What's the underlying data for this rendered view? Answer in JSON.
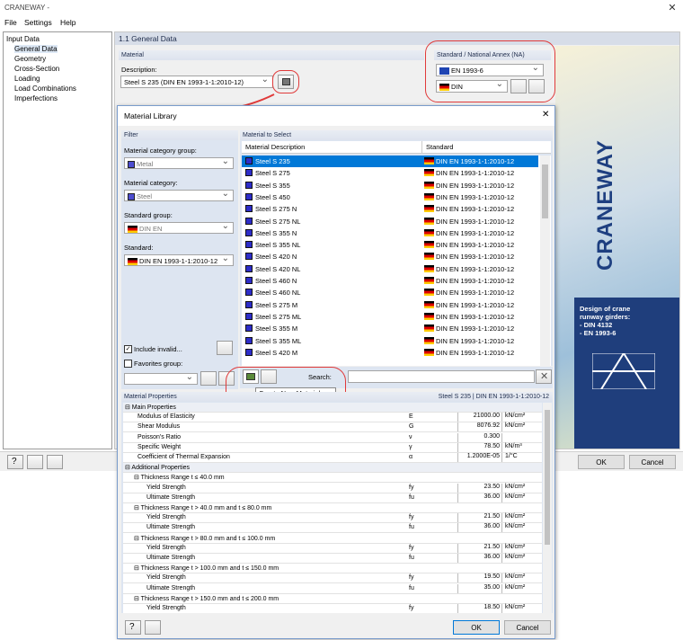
{
  "window": {
    "title": "CRANEWAY -",
    "close": "✕"
  },
  "menu": [
    "File",
    "Settings",
    "Help"
  ],
  "nav": {
    "root": "Input Data",
    "items": [
      "General Data",
      "Geometry",
      "Cross-Section",
      "Loading",
      "Load Combinations",
      "Imperfections"
    ]
  },
  "main": {
    "header": "1.1 General Data",
    "material_section": "Material",
    "description_label": "Description:",
    "description_value": "Steel S 235 (DIN EN 1993-1-1:2010-12)",
    "standard_section": "Standard / National Annex (NA)",
    "standard_value": "EN 1993-6",
    "na_value": "DIN"
  },
  "banner": {
    "word": "CRANEWAY",
    "text1": "Design of crane",
    "text2": "runway girders:",
    "text3": "- DIN 4132",
    "text4": "- EN 1993-6"
  },
  "bottom": {
    "ok": "OK",
    "cancel": "Cancel"
  },
  "dialog": {
    "title": "Material Library",
    "close": "✕",
    "filter": {
      "header": "Filter",
      "cat_group_label": "Material category group:",
      "cat_group_value": "Metal",
      "cat_label": "Material category:",
      "cat_value": "Steel",
      "std_group_label": "Standard group:",
      "std_group_value": "DIN EN",
      "std_label": "Standard:",
      "std_value": "DIN EN 1993-1-1:2010-12",
      "include_invalid": "Include invalid...",
      "favorites": "Favorites group:"
    },
    "select": {
      "header": "Material to Select",
      "col_desc": "Material Description",
      "col_std": "Standard",
      "rows": [
        [
          "Steel S 235",
          "DIN EN 1993-1-1:2010-12"
        ],
        [
          "Steel S 275",
          "DIN EN 1993-1-1:2010-12"
        ],
        [
          "Steel S 355",
          "DIN EN 1993-1-1:2010-12"
        ],
        [
          "Steel S 450",
          "DIN EN 1993-1-1:2010-12"
        ],
        [
          "Steel S 275 N",
          "DIN EN 1993-1-1:2010-12"
        ],
        [
          "Steel S 275 NL",
          "DIN EN 1993-1-1:2010-12"
        ],
        [
          "Steel S 355 N",
          "DIN EN 1993-1-1:2010-12"
        ],
        [
          "Steel S 355 NL",
          "DIN EN 1993-1-1:2010-12"
        ],
        [
          "Steel S 420 N",
          "DIN EN 1993-1-1:2010-12"
        ],
        [
          "Steel S 420 NL",
          "DIN EN 1993-1-1:2010-12"
        ],
        [
          "Steel S 460 N",
          "DIN EN 1993-1-1:2010-12"
        ],
        [
          "Steel S 460 NL",
          "DIN EN 1993-1-1:2010-12"
        ],
        [
          "Steel S 275 M",
          "DIN EN 1993-1-1:2010-12"
        ],
        [
          "Steel S 275 ML",
          "DIN EN 1993-1-1:2010-12"
        ],
        [
          "Steel S 355 M",
          "DIN EN 1993-1-1:2010-12"
        ],
        [
          "Steel S 355 ML",
          "DIN EN 1993-1-1:2010-12"
        ],
        [
          "Steel S 420 M",
          "DIN EN 1993-1-1:2010-12"
        ]
      ],
      "search_label": "Search:",
      "tooltip": "Create New Material..."
    },
    "props": {
      "header": "Material Properties",
      "header_right": "Steel S 235  |  DIN EN 1993-1-1:2010-12",
      "rows": [
        {
          "t": "group",
          "label": "⊟ Main Properties"
        },
        {
          "t": "item",
          "label": "Modulus of Elasticity",
          "sym": "E",
          "val": "21000.00",
          "unit": "kN/cm²"
        },
        {
          "t": "item",
          "label": "Shear Modulus",
          "sym": "G",
          "val": "8076.92",
          "unit": "kN/cm²"
        },
        {
          "t": "item",
          "label": "Poisson's Ratio",
          "sym": "ν",
          "val": "0.300",
          "unit": ""
        },
        {
          "t": "item",
          "label": "Specific Weight",
          "sym": "γ",
          "val": "78.50",
          "unit": "kN/m³"
        },
        {
          "t": "item",
          "label": "Coefficient of Thermal Expansion",
          "sym": "α",
          "val": "1.2000E-05",
          "unit": "1/°C"
        },
        {
          "t": "group",
          "label": "⊟ Additional Properties"
        },
        {
          "t": "sub",
          "label": "⊟ Thickness Range t ≤ 40.0 mm"
        },
        {
          "t": "leaf",
          "label": "Yield Strength",
          "sym": "fy",
          "val": "23.50",
          "unit": "kN/cm²"
        },
        {
          "t": "leaf",
          "label": "Ultimate Strength",
          "sym": "fu",
          "val": "36.00",
          "unit": "kN/cm²"
        },
        {
          "t": "sub",
          "label": "⊟ Thickness Range t > 40.0 mm and t ≤ 80.0 mm"
        },
        {
          "t": "leaf",
          "label": "Yield Strength",
          "sym": "fy",
          "val": "21.50",
          "unit": "kN/cm²"
        },
        {
          "t": "leaf",
          "label": "Ultimate Strength",
          "sym": "fu",
          "val": "36.00",
          "unit": "kN/cm²"
        },
        {
          "t": "sub",
          "label": "⊟ Thickness Range t > 80.0 mm and t ≤ 100.0 mm"
        },
        {
          "t": "leaf",
          "label": "Yield Strength",
          "sym": "fy",
          "val": "21.50",
          "unit": "kN/cm²"
        },
        {
          "t": "leaf",
          "label": "Ultimate Strength",
          "sym": "fu",
          "val": "36.00",
          "unit": "kN/cm²"
        },
        {
          "t": "sub",
          "label": "⊟ Thickness Range t > 100.0 mm and t ≤ 150.0 mm"
        },
        {
          "t": "leaf",
          "label": "Yield Strength",
          "sym": "fy",
          "val": "19.50",
          "unit": "kN/cm²"
        },
        {
          "t": "leaf",
          "label": "Ultimate Strength",
          "sym": "fu",
          "val": "35.00",
          "unit": "kN/cm²"
        },
        {
          "t": "sub",
          "label": "⊟ Thickness Range t > 150.0 mm and t ≤ 200.0 mm"
        },
        {
          "t": "leaf",
          "label": "Yield Strength",
          "sym": "fy",
          "val": "18.50",
          "unit": "kN/cm²"
        }
      ]
    },
    "ok": "OK",
    "cancel": "Cancel"
  },
  "colors": {
    "accent": "#0078d7",
    "highlight": "#e03a3a",
    "brand": "#1f3e7c"
  }
}
